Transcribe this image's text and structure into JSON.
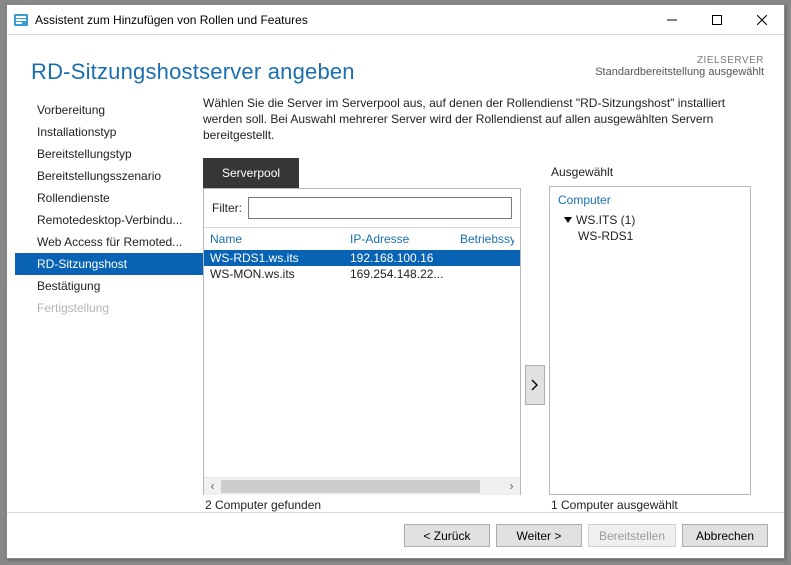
{
  "window": {
    "title": "Assistent zum Hinzufügen von Rollen und Features"
  },
  "header": {
    "page_title": "RD-Sitzungshostserver angeben",
    "target_label": "ZIELSERVER",
    "target_value": "Standardbereitstellung ausgewählt"
  },
  "nav": {
    "items": [
      {
        "label": "Vorbereitung",
        "state": ""
      },
      {
        "label": "Installationstyp",
        "state": ""
      },
      {
        "label": "Bereitstellungstyp",
        "state": ""
      },
      {
        "label": "Bereitstellungsszenario",
        "state": ""
      },
      {
        "label": "Rollendienste",
        "state": ""
      },
      {
        "label": "Remotedesktop-Verbindu...",
        "state": ""
      },
      {
        "label": "Web Access für Remoted...",
        "state": ""
      },
      {
        "label": "RD-Sitzungshost",
        "state": "selected"
      },
      {
        "label": "Bestätigung",
        "state": ""
      },
      {
        "label": "Fertigstellung",
        "state": "disabled"
      }
    ]
  },
  "content": {
    "description": "Wählen Sie die Server im Serverpool aus, auf denen der Rollendienst \"RD-Sitzungshost\" installiert werden soll. Bei Auswahl mehrerer Server wird der Rollendienst auf allen ausgewählten Servern bereitgestellt.",
    "pool_tab": "Serverpool",
    "filter_label": "Filter:",
    "filter_value": "",
    "columns": {
      "name": "Name",
      "ip": "IP-Adresse",
      "os": "Betriebssy"
    },
    "rows": [
      {
        "name": "WS-RDS1.ws.its",
        "ip": "192.168.100.16",
        "os": "",
        "selected": true
      },
      {
        "name": "WS-MON.ws.its",
        "ip": "169.254.148.22...",
        "os": "",
        "selected": false
      }
    ],
    "found_text": "2 Computer gefunden",
    "selected_label": "Ausgewählt",
    "selected_header": "Computer",
    "selected_group": "WS.ITS (1)",
    "selected_items": [
      "WS-RDS1"
    ],
    "selected_count_text": "1 Computer ausgewählt"
  },
  "buttons": {
    "back": "< Zurück",
    "next": "Weiter >",
    "deploy": "Bereitstellen",
    "cancel": "Abbrechen"
  }
}
